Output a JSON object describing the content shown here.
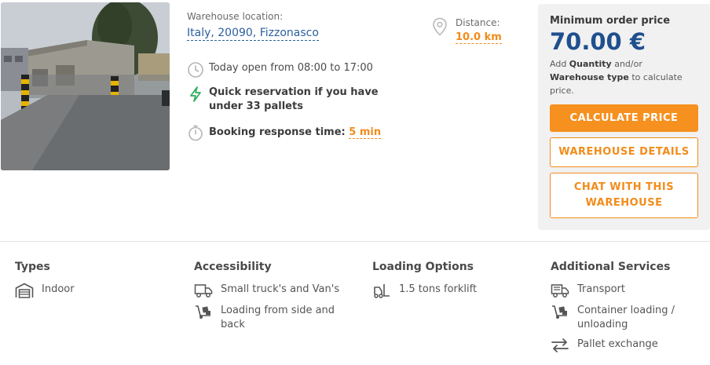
{
  "listing": {
    "photo_alt": "warehouse-exterior-photo",
    "location_label": "Warehouse location:",
    "location_value": "Italy, 20090, Fizzonasco",
    "hours": "Today open from 08:00 to 17:00",
    "quick_reservation": "Quick reservation if you have under 33 pallets",
    "booking_label": "Booking response time:",
    "booking_value": "5 min",
    "distance_label": "Distance:",
    "distance_value": "10.0 km"
  },
  "price": {
    "label": "Minimum order price",
    "value": "70.00 €",
    "note_prefix": "Add ",
    "note_quantity": "Quantity",
    "note_mid": " and/or ",
    "note_type": "Warehouse type",
    "note_suffix": " to calculate price.",
    "calculate_button": "CALCULATE PRICE",
    "details_button": "WAREHOUSE DETAILS",
    "chat_button_line1": "CHAT WITH THIS",
    "chat_button_line2": "WAREHOUSE"
  },
  "features": {
    "types": {
      "title": "Types",
      "items": [
        "Indoor"
      ]
    },
    "accessibility": {
      "title": "Accessibility",
      "items": [
        "Small truck's and Van's",
        "Loading from side and",
        "back"
      ]
    },
    "loading": {
      "title": "Loading Options",
      "items": [
        "1.5 tons forklift"
      ]
    },
    "services": {
      "title": "Additional Services",
      "items": [
        "Transport",
        "Container loading /",
        "unloading",
        "Pallet exchange"
      ]
    }
  },
  "colors": {
    "accent": "#f6901e",
    "primary_blue": "#1f4f8e",
    "link_blue": "#2a5f9e",
    "panel_bg": "#f1f1f1"
  },
  "icons": [
    "clock-icon",
    "lightning-icon",
    "stopwatch-icon",
    "map-pin-icon",
    "garage-icon",
    "truck-icon",
    "hand-truck-icon",
    "forklift-icon",
    "transport-truck-icon",
    "exchange-icon"
  ]
}
